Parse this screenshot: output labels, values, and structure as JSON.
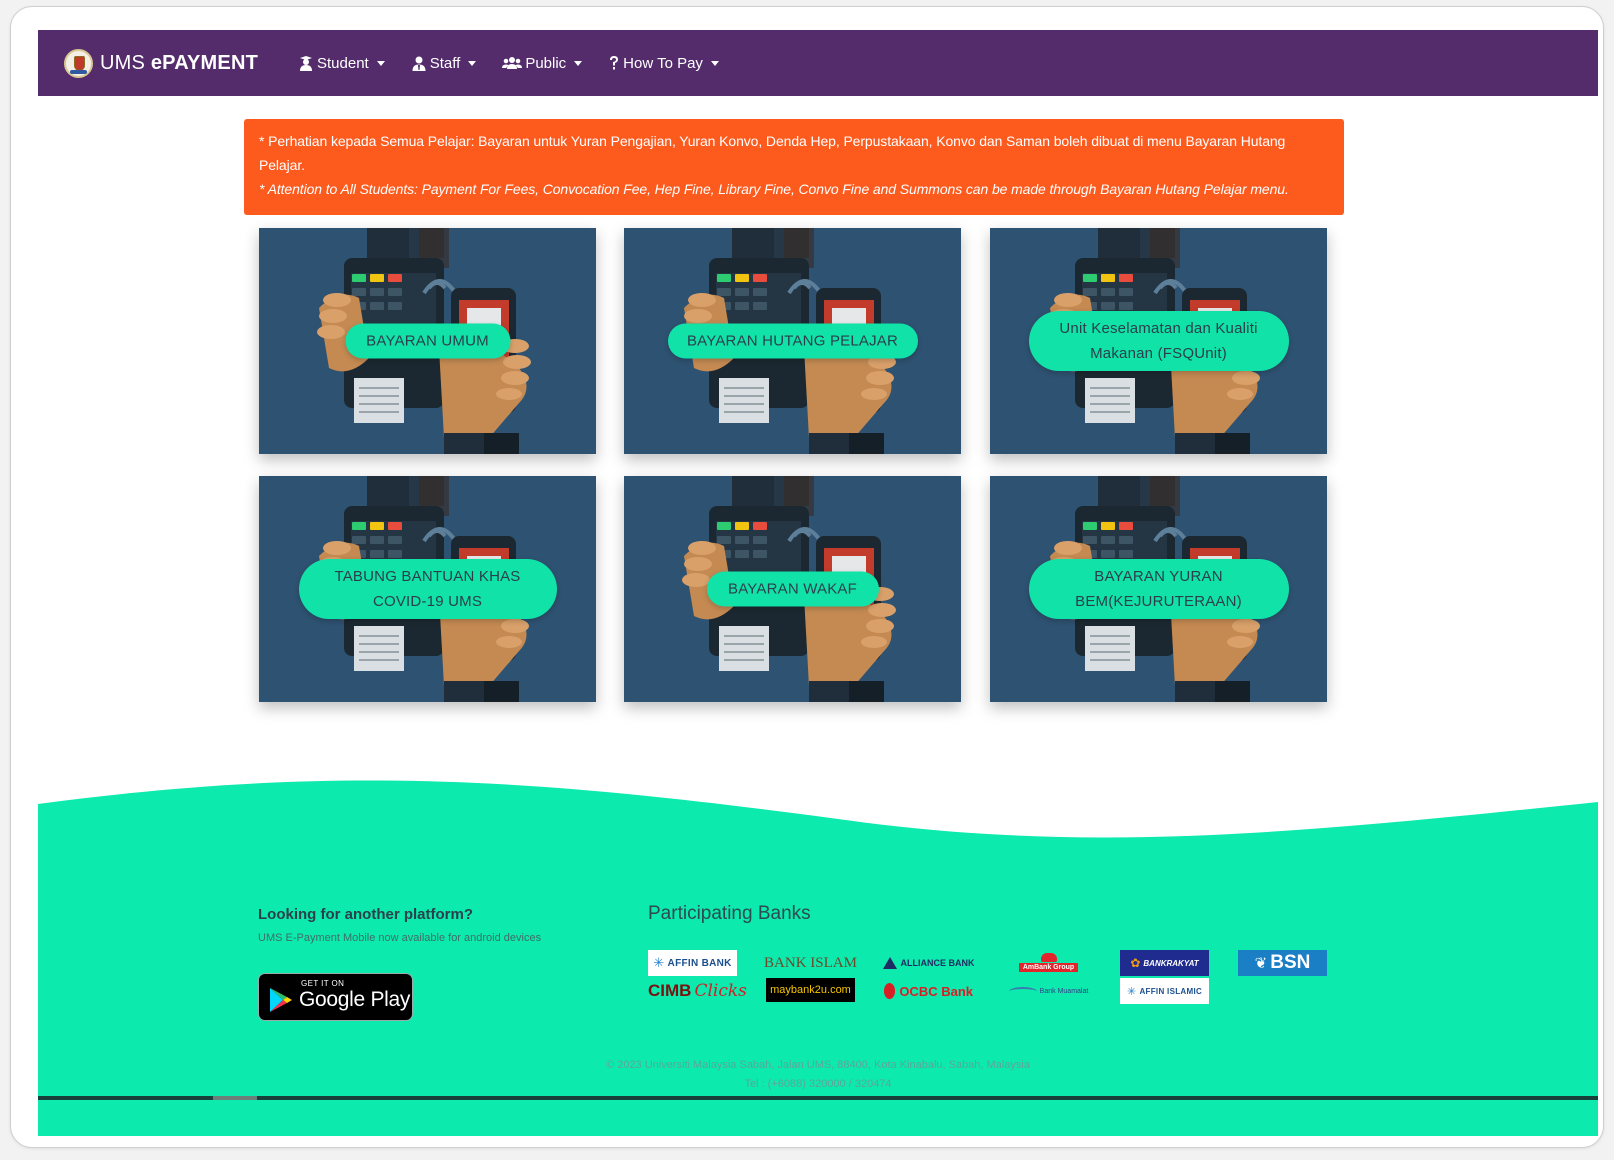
{
  "navbar": {
    "brand_light": "UMS ",
    "brand_bold": "ePAYMENT",
    "items": [
      {
        "label": "Student",
        "icon": "student-icon"
      },
      {
        "label": "Staff",
        "icon": "staff-icon"
      },
      {
        "label": "Public",
        "icon": "users-icon"
      },
      {
        "label": "How To Pay",
        "icon": "question-icon"
      }
    ]
  },
  "alert": {
    "line_ms": "* Perhatian kepada Semua Pelajar: Bayaran untuk Yuran Pengajian, Yuran Konvo, Denda Hep, Perpustakaan, Konvo dan Saman boleh dibuat di menu Bayaran Hutang Pelajar.",
    "line_en": "* Attention to All Students: Payment For Fees, Convocation Fee, Hep Fine, Library Fine, Convo Fine and Summons can be made through Bayaran Hutang Pelajar menu."
  },
  "cards": [
    {
      "line1": "BAYARAN UMUM",
      "line2": ""
    },
    {
      "line1": "BAYARAN HUTANG PELAJAR",
      "line2": ""
    },
    {
      "line1": "Unit Keselamatan dan Kualiti",
      "line2": "Makanan (FSQUnit)"
    },
    {
      "line1": "TABUNG BANTUAN KHAS",
      "line2": "COVID-19 UMS"
    },
    {
      "line1": "BAYARAN WAKAF",
      "line2": ""
    },
    {
      "line1": "BAYARAN YURAN",
      "line2": "BEM(KEJURUTERAAN)"
    }
  ],
  "footer": {
    "platform_title": "Looking for another platform?",
    "platform_sub": "UMS E-Payment Mobile now available for android devices",
    "gplay_small": "GET IT ON",
    "gplay_big": "Google Play",
    "banks_title": "Participating Banks",
    "banks": {
      "affin": "AFFIN BANK",
      "cimb": "CIMB",
      "cimb_clicks": "Clicks",
      "bislam": "BANK ISLAM",
      "maybank": "maybank2u.com",
      "alliance": "ALLIANCE BANK",
      "ocbc": "OCBC Bank",
      "ambank": "AmBank Group",
      "muamalat": "Bank Muamalat",
      "rakyat": "BANKRAKYAT",
      "affin_islamic": "AFFIN ISLAMIC",
      "bsn": "BSN"
    },
    "copyright": "© 2023 Universiti Malaysia Sabah, Jalan UMS, 88400, Kota Kinabalu, Sabah, Malaysia",
    "tel": "Tel : (+6088) 320000 / 320474"
  },
  "colors": {
    "navbar": "#542c6c",
    "alert": "#fd5a1e",
    "card_bg": "#2e5271",
    "accent": "#11e2a8"
  }
}
